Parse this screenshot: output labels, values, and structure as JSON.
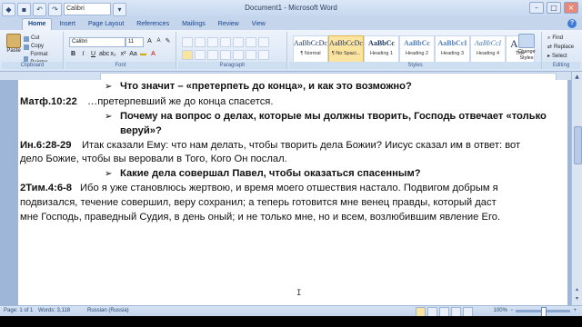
{
  "window": {
    "title": "Document1 - Microsoft Word",
    "qat_font": "Calibri",
    "minimize": "–",
    "maximize": "□",
    "close": "×"
  },
  "tabs": [
    "Home",
    "Insert",
    "Page Layout",
    "References",
    "Mailings",
    "Review",
    "View"
  ],
  "ribbon": {
    "clipboard": {
      "paste": "Paste",
      "cut": "Cut",
      "copy": "Copy",
      "format_painter": "Format Painter",
      "label": "Clipboard"
    },
    "font": {
      "name": "Calibri",
      "size": "11",
      "label": "Font"
    },
    "paragraph": {
      "label": "Paragraph"
    },
    "styles": {
      "items": [
        {
          "sample": "AaBbCcDc",
          "name": "¶ Normal"
        },
        {
          "sample": "AaBbCcDc",
          "name": "¶ No Spaci..."
        },
        {
          "sample": "AaBbCc",
          "name": "Heading 1"
        },
        {
          "sample": "AaBbCc",
          "name": "Heading 2"
        },
        {
          "sample": "AaBbCcI",
          "name": "Heading 3"
        },
        {
          "sample": "AaBbCcI",
          "name": "Heading 4"
        },
        {
          "sample": "AaB",
          "name": "Title"
        }
      ],
      "change_styles": "Change Styles",
      "label": "Styles"
    },
    "editing": {
      "find": "Find",
      "replace": "Replace",
      "select": "Select",
      "label": "Editing"
    }
  },
  "document": {
    "lines": [
      "Что значит – «претерпеть до конца», и как это возможно?",
      "Матф.10:22",
      "…претерпевший же до конца спасется.",
      "Почему на вопрос о делах, которые мы должны творить, Господь отвечает «только",
      "веруй»?",
      "Ин.6:28-29",
      "Итак сказали Ему: что нам делать, чтобы творить дела Божии? Иисус сказал им в ответ: вот",
      "дело Божие, чтобы вы веровали в Того, Кого Он послал.",
      "Какие дела совершал Павел, чтобы оказаться спасенным?",
      "2Тим.4:6-8",
      "Ибо я уже становлюсь жертвою, и время моего отшествия настало. Подвигом добрым я",
      "подвизался, течение совершил, веру сохранил; а теперь готовится мне венец правды, который даст",
      "мне Господь, праведный Судия, в день оный; и не только мне, но и всем, возлюбившим явление Его."
    ]
  },
  "statusbar": {
    "page": "Page: 1 of 1",
    "words": "Words: 3,118",
    "language": "Russian (Russia)",
    "zoom": "100%"
  }
}
